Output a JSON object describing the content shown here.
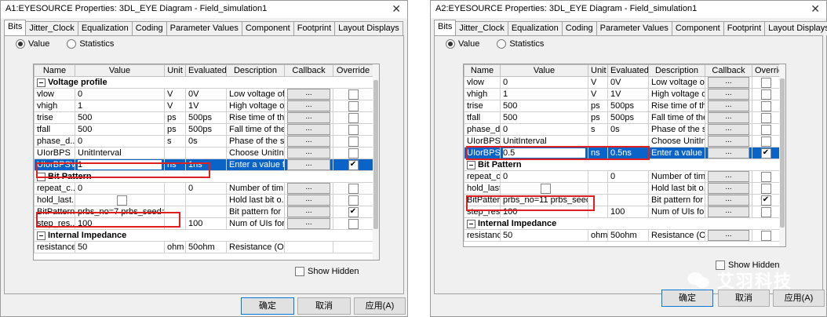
{
  "left": {
    "title": "A1:EYESOURCE Properties: 3DL_EYE Diagram - Field_simulation1",
    "close": "✕",
    "tabs": [
      "Bits",
      "Jitter_Clock",
      "Equalization",
      "Coding",
      "Parameter Values",
      "Component",
      "Footprint",
      "Layout Displays"
    ],
    "radio_value": "Value",
    "radio_statistics": "Statistics",
    "headers": [
      "Name",
      "Value",
      "Unit",
      "Evaluated...",
      "Description",
      "Callback",
      "Override"
    ],
    "group_voltage": "Voltage profile",
    "group_bit": "Bit Pattern",
    "group_imp": "Internal Impedance",
    "rows": [
      {
        "name": "vlow",
        "value": "0",
        "unit": "V",
        "eval": "0V",
        "desc": "Low voltage of...",
        "cb": "..."
      },
      {
        "name": "vhigh",
        "value": "1",
        "unit": "V",
        "eval": "1V",
        "desc": "High voltage o...",
        "cb": "..."
      },
      {
        "name": "trise",
        "value": "500",
        "unit": "ps",
        "eval": "500ps",
        "desc": "Rise time of th...",
        "cb": "..."
      },
      {
        "name": "tfall",
        "value": "500",
        "unit": "ps",
        "eval": "500ps",
        "desc": "Fall time of the...",
        "cb": "..."
      },
      {
        "name": "phase_d...",
        "value": "0",
        "unit": "s",
        "eval": "0s",
        "desc": "Phase of the s...",
        "cb": "..."
      },
      {
        "name": "UIorBPS",
        "value": "UnitInterval",
        "unit": "",
        "eval": "",
        "desc": "Choose UnitInt...",
        "cb": "..."
      },
      {
        "name": "UIorBPSV...",
        "value": "1",
        "unit": "ns",
        "eval": "1ns",
        "desc": "Enter a value f...",
        "cb": "..."
      }
    ],
    "bitrows": [
      {
        "name": "repeat_c...",
        "value": "0",
        "unit": "",
        "eval": "0",
        "desc": "Number of tim...",
        "cb": "..."
      },
      {
        "name": "hold_last...",
        "value": "",
        "unit": "",
        "eval": "",
        "desc": "Hold last bit o...",
        "cb": "..."
      },
      {
        "name": "BitPattern",
        "value": "prbs_no=7 prbs_seed=...",
        "unit": "",
        "eval": "",
        "desc": "Bit pattern for ...",
        "cb": "..."
      },
      {
        "name": "step_res...",
        "value": "100",
        "unit": "",
        "eval": "100",
        "desc": "Num of UIs for...",
        "cb": "..."
      }
    ],
    "partial": {
      "name": "resistance",
      "value": "50",
      "unit": "ohm",
      "eval": "50ohm",
      "desc": "Resistance (Oh..."
    },
    "show_hidden": "Show Hidden",
    "ok": "确定",
    "cancel": "取消",
    "apply": "应用(A)"
  },
  "right": {
    "title": "A2:EYESOURCE Properties: 3DL_EYE Diagram - Field_simulation1",
    "close": "✕",
    "tabs": [
      "Bits",
      "Jitter_Clock",
      "Equalization",
      "Coding",
      "Parameter Values",
      "Component",
      "Footprint",
      "Layout Displays"
    ],
    "radio_value": "Value",
    "radio_statistics": "Statistics",
    "headers": [
      "Name",
      "Value",
      "Unit",
      "Evaluated...",
      "Description",
      "Callback",
      "Override"
    ],
    "group_bit": "Bit Pattern",
    "group_imp": "Internal Impedance",
    "rows": [
      {
        "name": "vlow",
        "value": "0",
        "unit": "V",
        "eval": "0V",
        "desc": "Low voltage of...",
        "cb": "..."
      },
      {
        "name": "vhigh",
        "value": "1",
        "unit": "V",
        "eval": "1V",
        "desc": "High voltage o...",
        "cb": "..."
      },
      {
        "name": "trise",
        "value": "500",
        "unit": "ps",
        "eval": "500ps",
        "desc": "Rise time of th...",
        "cb": "..."
      },
      {
        "name": "tfall",
        "value": "500",
        "unit": "ps",
        "eval": "500ps",
        "desc": "Fall time of the...",
        "cb": "..."
      },
      {
        "name": "phase_d...",
        "value": "0",
        "unit": "s",
        "eval": "0s",
        "desc": "Phase of the s...",
        "cb": "..."
      },
      {
        "name": "UIorBPS",
        "value": "UnitInterval",
        "unit": "",
        "eval": "",
        "desc": "Choose UnitInt...",
        "cb": "..."
      },
      {
        "name": "UIorBPSV...",
        "value": "0.5",
        "unit": "ns",
        "eval": "0.5ns",
        "desc": "Enter a value f...",
        "cb": "..."
      }
    ],
    "bitrows": [
      {
        "name": "repeat_c...",
        "value": "0",
        "unit": "",
        "eval": "0",
        "desc": "Number of tim...",
        "cb": "..."
      },
      {
        "name": "hold_last...",
        "value": "",
        "unit": "",
        "eval": "",
        "desc": "Hold last bit o...",
        "cb": "..."
      },
      {
        "name": "BitPattern",
        "value": "prbs_no=11 prbs_seed...",
        "unit": "",
        "eval": "",
        "desc": "Bit pattern for ...",
        "cb": "..."
      },
      {
        "name": "step_res...",
        "value": "100",
        "unit": "",
        "eval": "100",
        "desc": "Num of UIs for...",
        "cb": "..."
      }
    ],
    "improw": {
      "name": "resistance",
      "value": "50",
      "unit": "ohm",
      "eval": "50ohm",
      "desc": "Resistance (Oh...",
      "cb": "..."
    },
    "show_hidden": "Show Hidden",
    "ok": "确定",
    "cancel": "取消",
    "apply": "应用(A)"
  },
  "watermark": "艾羽科技"
}
